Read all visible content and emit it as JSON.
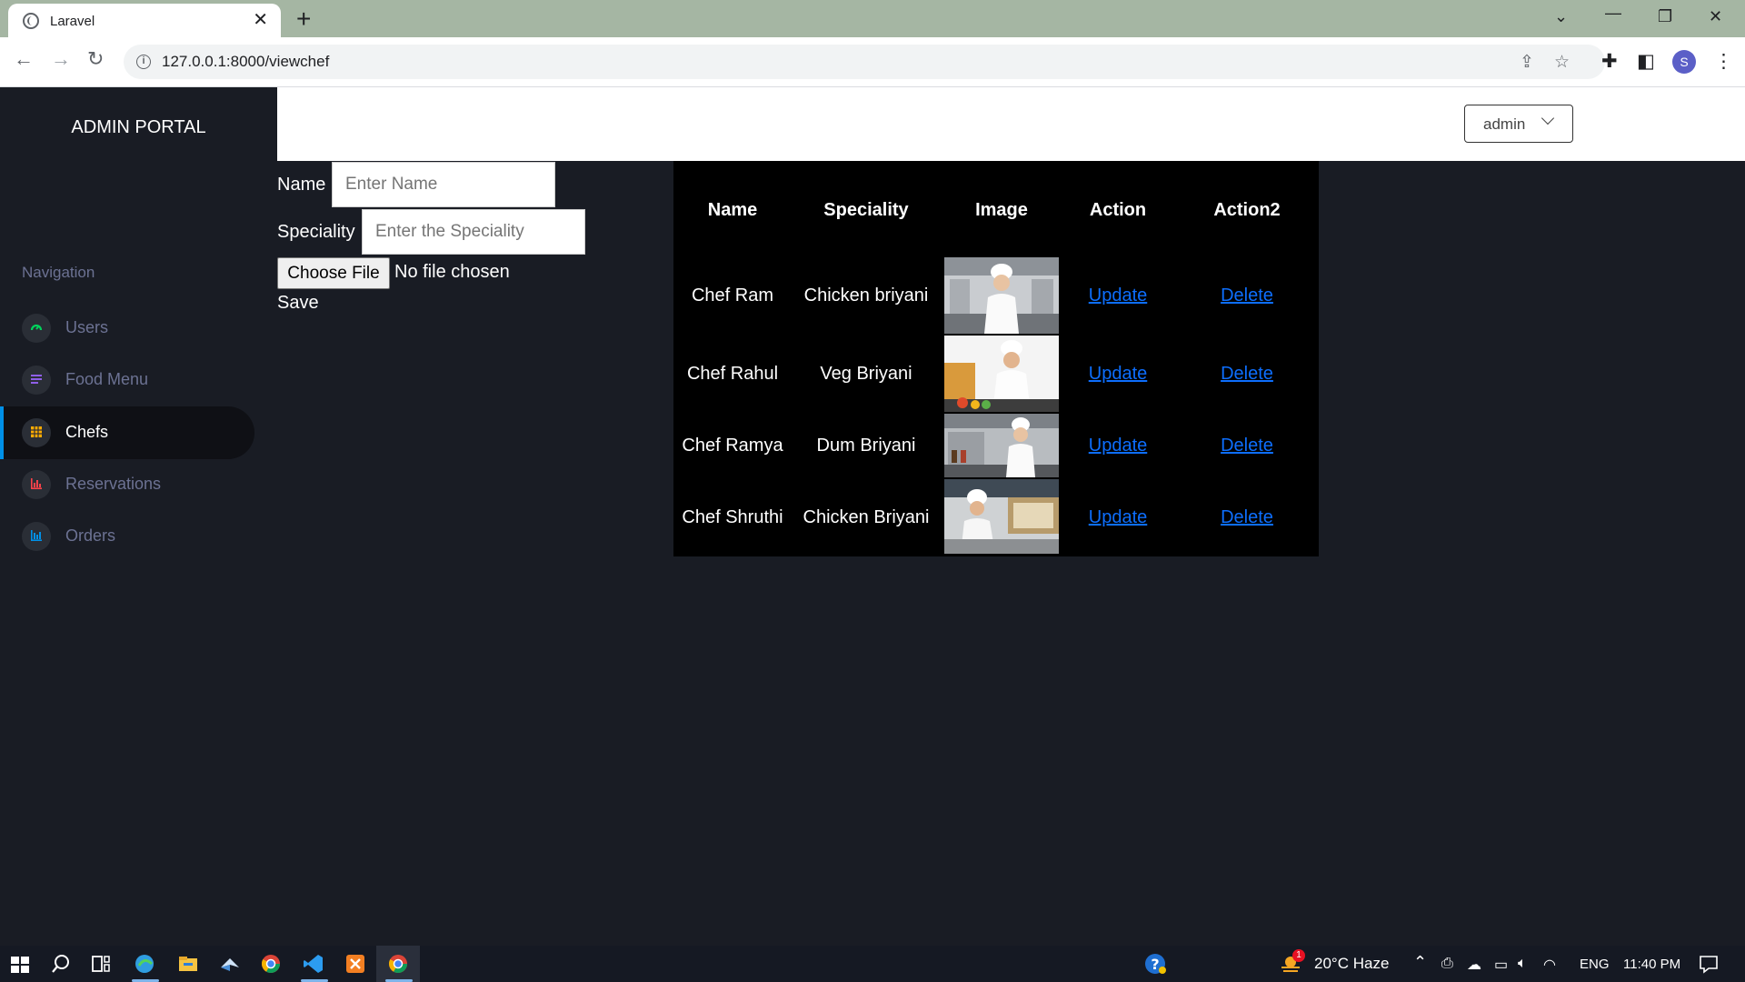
{
  "browser": {
    "tab_title": "Laravel",
    "url": "127.0.0.1:8000/viewchef",
    "profile_initial": "S"
  },
  "sidebar": {
    "brand": "ADMIN PORTAL",
    "nav_heading": "Navigation",
    "items": [
      {
        "label": "Users",
        "icon": "speedometer-icon",
        "color": "#00d25b"
      },
      {
        "label": "Food Menu",
        "icon": "menu-lines-icon",
        "color": "#8f5fe8"
      },
      {
        "label": "Chefs",
        "icon": "table-grid-icon",
        "color": "#ffab00",
        "active": true
      },
      {
        "label": "Reservations",
        "icon": "bar-chart-icon",
        "color": "#fc424a"
      },
      {
        "label": "Orders",
        "icon": "column-chart-icon",
        "color": "#0090e7"
      }
    ]
  },
  "topbar": {
    "user_menu_label": "admin"
  },
  "form": {
    "name_label": "Name",
    "name_placeholder": "Enter Name",
    "speciality_label": "Speciality",
    "speciality_placeholder": "Enter the Speciality",
    "choose_file_label": "Choose File",
    "no_file_text": "No file chosen",
    "save_label": "Save"
  },
  "table": {
    "headers": [
      "Name",
      "Speciality",
      "Image",
      "Action",
      "Action2"
    ],
    "rows": [
      {
        "name": "Chef Ram",
        "speciality": "Chicken briyani",
        "action": "Update",
        "action2": "Delete"
      },
      {
        "name": "Chef Rahul",
        "speciality": "Veg Briyani",
        "action": "Update",
        "action2": "Delete"
      },
      {
        "name": "Chef Ramya",
        "speciality": "Dum Briyani",
        "action": "Update",
        "action2": "Delete"
      },
      {
        "name": "Chef Shruthi",
        "speciality": "Chicken Briyani",
        "action": "Update",
        "action2": "Delete"
      }
    ]
  },
  "taskbar": {
    "weather": "20°C  Haze",
    "weather_badge": "1",
    "language": "ENG",
    "time": "11:40 PM"
  }
}
